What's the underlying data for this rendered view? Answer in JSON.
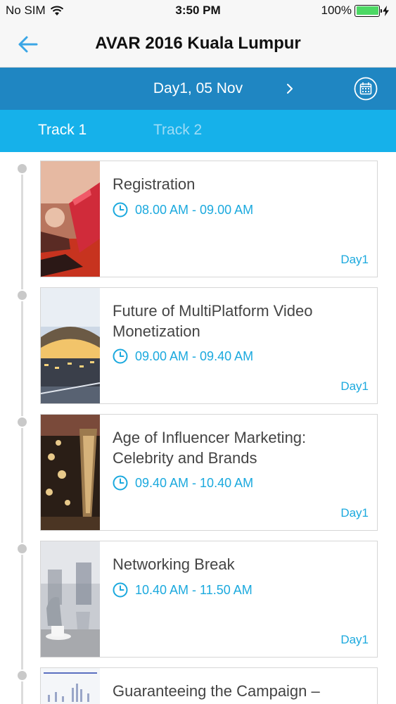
{
  "status_bar": {
    "carrier": "No SIM",
    "time": "3:50 PM",
    "battery": "100%"
  },
  "nav": {
    "title": "AVAR 2016 Kuala Lumpur",
    "back_icon": "back-arrow-icon"
  },
  "date_bar": {
    "label": "Day1, 05 Nov",
    "next_icon": "chevron-right-icon",
    "calendar_icon": "calendar-icon"
  },
  "tabs": [
    {
      "label": "Track 1",
      "active": true
    },
    {
      "label": "Track 2",
      "active": false
    }
  ],
  "sessions": [
    {
      "title": "Registration",
      "time": "08.00 AM - 09.00 AM",
      "day": "Day1",
      "image": "registration-photo"
    },
    {
      "title": "Future of MultiPlatform Video Monetization",
      "time": "09.00 AM - 09.40 AM",
      "day": "Day1",
      "image": "airport-photo"
    },
    {
      "title": "Age of Influencer Marketing: Celebrity and Brands",
      "time": "09.40 AM - 10.40 AM",
      "day": "Day1",
      "image": "awards-photo"
    },
    {
      "title": "Networking Break",
      "time": "10.40 AM - 11.50 AM",
      "day": "Day1",
      "image": "coffee-photo"
    },
    {
      "title": "Guaranteeing the Campaign –",
      "time": "",
      "day": "",
      "image": "chart-photo"
    }
  ],
  "colors": {
    "date_bar": "#1f86c2",
    "tab_bar": "#16b1ea",
    "accent": "#1ba9de"
  }
}
